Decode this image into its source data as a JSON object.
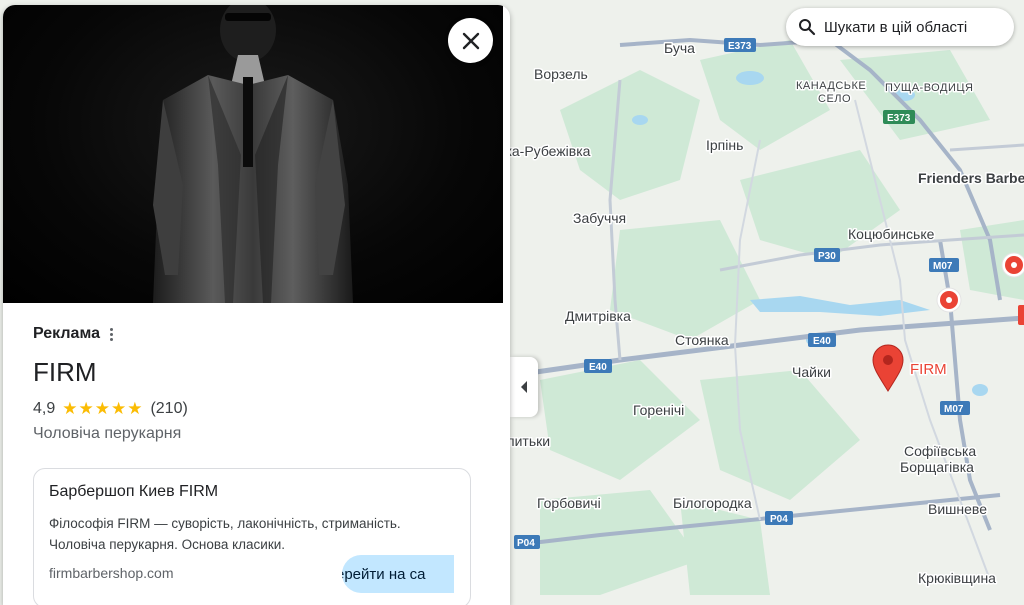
{
  "map": {
    "search_area_label": "Шукати в цій області",
    "places": {
      "bucha": "Буча",
      "vorzel": "Ворзель",
      "kanadske_1": "КАНАДСЬКЕ",
      "kanadske_2": "СЕЛО",
      "pushcha": "ПУЩА-ВОДИЦЯ",
      "irpin": "Ірпінь",
      "rubezhivka": "вка-Рубежівка",
      "zabuchchia": "Забуччя",
      "kotsiubynske": "Коцюбинське",
      "friendersbarber": "Frienders Barbe",
      "dmytrivka": "Дмитрівка",
      "stoianka": "Стоянка",
      "chaiky": "Чайки",
      "horenychi": "Горенічі",
      "pytky": "питьки",
      "sofiivska_1": "Софіївська",
      "sofiivska_2": "Борщагівка",
      "horbovychi": "Горбовичі",
      "bilohorodka": "Білогородка",
      "vyshneve": "Вишневе",
      "kriukivshchyna": "Крюківщина"
    },
    "roads": {
      "e373_a": "E373",
      "e373_b": "E373",
      "p30": "P30",
      "m07_a": "M07",
      "e40_a": "E40",
      "e40_b": "E40",
      "m07_b": "M07",
      "p04_a": "P04",
      "p04_b": "P04"
    },
    "selected_pin_label": "FIRM",
    "colors": {
      "land": "#eef1ec",
      "forest": "#cfe9d6",
      "water": "#a8d7f0",
      "highway": "#a6b4c8",
      "shield": "#3d7ab8",
      "pin": "#ea4335"
    }
  },
  "panel": {
    "close_icon": "close-icon",
    "ad_label": "Реклама",
    "name": "FIRM",
    "rating": "4,9",
    "stars": "★★★★★",
    "reviews": "(210)",
    "category": "Чоловіча перукарня",
    "ad": {
      "title": "Барбершоп Киев FIRM",
      "description": "Філософія FIRM — суворість, лаконічність, стриманість. Чоловіча перукарня. Основа класики.",
      "url": "firmbarbershop.com",
      "cta": "ерейти на са"
    }
  }
}
